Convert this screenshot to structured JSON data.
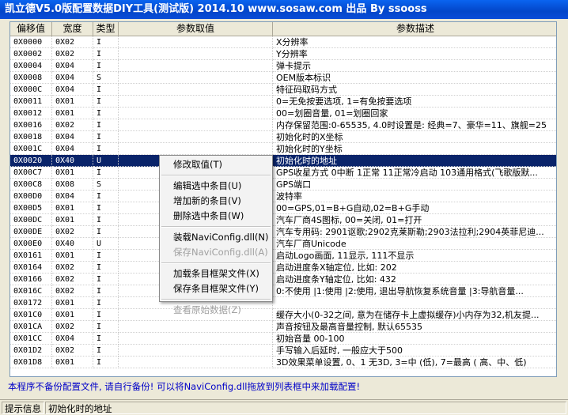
{
  "window": {
    "title": "凯立德V5.0版配置数据DIY工具(测试版) 2014.10  www.sosaw.com 出品 By ssooss"
  },
  "table": {
    "columns": [
      "偏移值",
      "宽度",
      "类型",
      "参数取值",
      "参数描述"
    ],
    "rows": [
      {
        "offset": "0X0000",
        "width": "0X02",
        "type": "I",
        "value": "",
        "desc": "X分辨率"
      },
      {
        "offset": "0X0002",
        "width": "0X02",
        "type": "I",
        "value": "",
        "desc": "Y分辨率"
      },
      {
        "offset": "0X0004",
        "width": "0X04",
        "type": "I",
        "value": "",
        "desc": "弹卡提示"
      },
      {
        "offset": "0X0008",
        "width": "0X04",
        "type": "S",
        "value": "",
        "desc": "OEM版本标识"
      },
      {
        "offset": "0X000C",
        "width": "0X04",
        "type": "I",
        "value": "",
        "desc": "特征码取码方式"
      },
      {
        "offset": "0X0011",
        "width": "0X01",
        "type": "I",
        "value": "",
        "desc": "0=无免按要选项, 1=有免按要选项"
      },
      {
        "offset": "0X0012",
        "width": "0X01",
        "type": "I",
        "value": "",
        "desc": "00=划圈音量, 01=划圈回家"
      },
      {
        "offset": "0X0016",
        "width": "0X02",
        "type": "I",
        "value": "",
        "desc": "内存保留范围:0-65535, 4.0时设置是: 经典=7、豪华=11、旗舰=25"
      },
      {
        "offset": "0X0018",
        "width": "0X04",
        "type": "I",
        "value": "",
        "desc": "初始化时的X坐标"
      },
      {
        "offset": "0X001C",
        "width": "0X04",
        "type": "I",
        "value": "",
        "desc": "初始化时的Y坐标"
      },
      {
        "offset": "0X0020",
        "width": "0X40",
        "type": "U",
        "value": "",
        "desc": "初始化时的地址"
      },
      {
        "offset": "0X00C7",
        "width": "0X01",
        "type": "I",
        "value": "",
        "desc": "GPS收星方式 0中断 1正常 11正常冷启动 103通用格式(飞歌版默..."
      },
      {
        "offset": "0X00C8",
        "width": "0X08",
        "type": "S",
        "value": "",
        "desc": "GPS端口"
      },
      {
        "offset": "0X00D0",
        "width": "0X04",
        "type": "I",
        "value": "",
        "desc": "波特率"
      },
      {
        "offset": "0X00D5",
        "width": "0X01",
        "type": "I",
        "value": "",
        "desc": "00=GPS,01=B+G自动,02=B+G手动"
      },
      {
        "offset": "0X00DC",
        "width": "0X01",
        "type": "I",
        "value": "",
        "desc": "汽车厂商4S图标, 00=关闭, 01=打开"
      },
      {
        "offset": "0X00DE",
        "width": "0X02",
        "type": "I",
        "value": "",
        "desc": "汽车专用码: 2901讴歌;2902克莱斯勒;2903法拉利;2904英菲尼迪..."
      },
      {
        "offset": "0X00E0",
        "width": "0X40",
        "type": "U",
        "value": "",
        "desc": "汽车厂商Unicode"
      },
      {
        "offset": "0X0161",
        "width": "0X01",
        "type": "I",
        "value": "",
        "desc": "启动Logo画面, 11显示, 111不显示"
      },
      {
        "offset": "0X0164",
        "width": "0X02",
        "type": "I",
        "value": "",
        "desc": "启动进度条X轴定位, 比如: 202"
      },
      {
        "offset": "0X0166",
        "width": "0X02",
        "type": "I",
        "value": "",
        "desc": "启动进度条Y轴定位, 比如: 432"
      },
      {
        "offset": "0X016C",
        "width": "0X02",
        "type": "I",
        "value": "",
        "desc": "0:不使用 |1:使用 |2:使用, 退出导航恢复系统音量 |3:导航音量..."
      },
      {
        "offset": "0X0172",
        "width": "0X01",
        "type": "I",
        "value": "",
        "desc": ""
      },
      {
        "offset": "0X01C0",
        "width": "0X01",
        "type": "I",
        "value": "",
        "desc": "缓存大小(0-32之间, 意为在储存卡上虚拟缓存)小内存为32,机友提..."
      },
      {
        "offset": "0X01CA",
        "width": "0X02",
        "type": "I",
        "value": "",
        "desc": "声音按钮及最高音量控制, 默认65535"
      },
      {
        "offset": "0X01CC",
        "width": "0X04",
        "type": "I",
        "value": "",
        "desc": "初始音量 00-100"
      },
      {
        "offset": "0X01D2",
        "width": "0X02",
        "type": "I",
        "value": "",
        "desc": "手写输入后延时, 一般应大于500"
      },
      {
        "offset": "0X01D8",
        "width": "0X01",
        "type": "I",
        "value": "",
        "desc": "3D效果菜单设置, 0、1 无3D, 3=中 (低), 7=最高 ( 高、中、低)"
      }
    ],
    "selected_index": 10
  },
  "context_menu": {
    "items": [
      {
        "label": "修改取值(T)",
        "disabled": false
      },
      {
        "sep": true
      },
      {
        "label": "编辑选中条目(U)",
        "disabled": false
      },
      {
        "label": "增加新的条目(V)",
        "disabled": false
      },
      {
        "label": "删除选中条目(W)",
        "disabled": false
      },
      {
        "sep": true
      },
      {
        "label": "装载NaviConfig.dll(N)",
        "disabled": false
      },
      {
        "label": "保存NaviConfig.dll(A)",
        "disabled": true
      },
      {
        "sep": true
      },
      {
        "label": "加载条目框架文件(X)",
        "disabled": false
      },
      {
        "label": "保存条目框架文件(Y)",
        "disabled": false
      },
      {
        "sep": true
      },
      {
        "label": "查看原始数据(Z)",
        "disabled": true
      }
    ]
  },
  "notice": "本程序不备份配置文件, 请自行备份! 可以将NaviConfig.dll拖放到列表框中来加载配置!",
  "status": {
    "label": "提示信息",
    "text": "初始化时的地址"
  }
}
